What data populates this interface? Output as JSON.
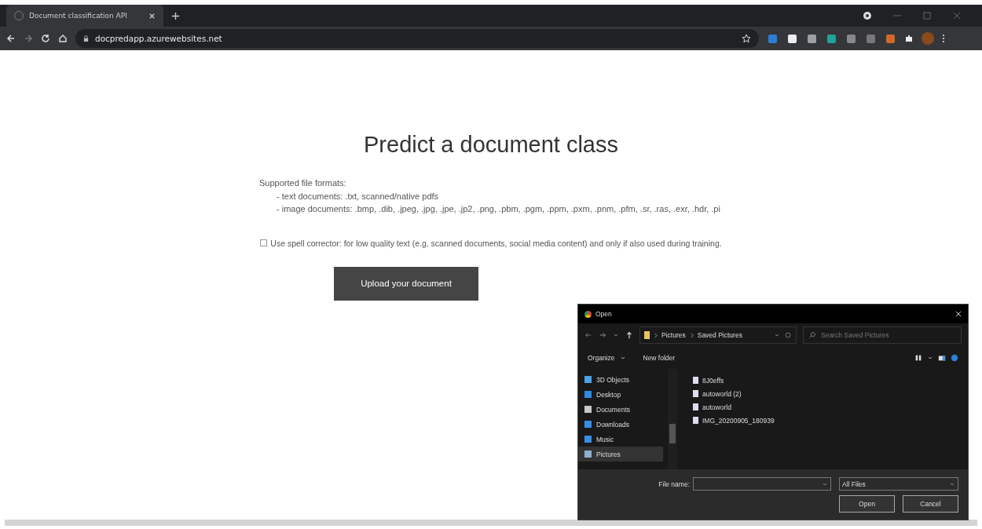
{
  "browser": {
    "tab_title": "Document classification API",
    "url": "docpredapp.azurewebsites.net"
  },
  "page": {
    "heading": "Predict a document class",
    "formats_title": "Supported file formats:",
    "formats": [
      "- text documents: .txt, scanned/native pdfs",
      "- image documents: .bmp, .dib, .jpeg, .jpg, .jpe, .jp2, .png, .pbm, .pgm, .ppm, .pxm, .pnm, .pfm, .sr, .ras, .exr, .hdr, .pi"
    ],
    "spell_checkbox": {
      "label": "Use spell corrector: for low quality text (e.g. scanned documents, social media content) and only if also used during training.",
      "checked": false
    },
    "upload_button": "Upload your document"
  },
  "dialog": {
    "title": "Open",
    "breadcrumb": [
      "Pictures",
      "Saved Pictures"
    ],
    "search_placeholder": "Search Saved Pictures",
    "organize": "Organize",
    "new_folder": "New folder",
    "nav": [
      {
        "label": "3D Objects",
        "kind": "objects",
        "selected": false
      },
      {
        "label": "Desktop",
        "kind": "desktop",
        "selected": false
      },
      {
        "label": "Documents",
        "kind": "documents",
        "selected": false
      },
      {
        "label": "Downloads",
        "kind": "downloads",
        "selected": false
      },
      {
        "label": "Music",
        "kind": "music",
        "selected": false
      },
      {
        "label": "Pictures",
        "kind": "pictures",
        "selected": true
      }
    ],
    "files": [
      "8J0effs",
      "autoworld (2)",
      "autoworld",
      "IMG_20200905_180939"
    ],
    "file_name_label": "File name:",
    "file_type": "All Files",
    "open_button": "Open",
    "cancel_button": "Cancel"
  }
}
